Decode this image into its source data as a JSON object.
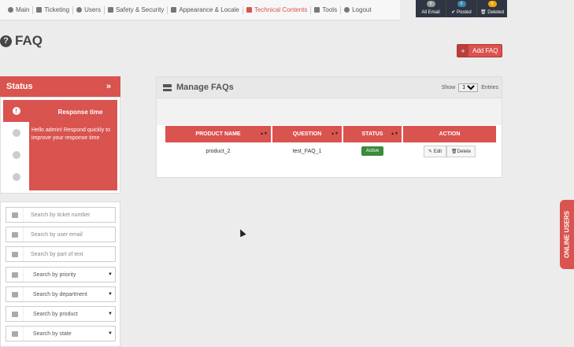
{
  "nav": {
    "items": [
      {
        "label": "Main",
        "icon": "target-icon"
      },
      {
        "label": "Ticketing",
        "icon": "tag-icon"
      },
      {
        "label": "Users",
        "icon": "users-icon"
      },
      {
        "label": "Safety & Security",
        "icon": "lock-icon"
      },
      {
        "label": "Appearance & Locale",
        "icon": "brush-icon"
      },
      {
        "label": "Technical Contents",
        "icon": "graduation-cap-icon"
      },
      {
        "label": "Tools",
        "icon": "wrench-icon"
      },
      {
        "label": "Logout",
        "icon": "logout-icon"
      }
    ],
    "active": "Technical Contents",
    "accent": "#d9534f"
  },
  "stats": [
    {
      "label": "All Email",
      "count": "0",
      "color": "#999999"
    },
    {
      "label": "Posted",
      "count": "0",
      "color": "#3a87ad"
    },
    {
      "label": "Deleted",
      "count": "0",
      "color": "#f0a30a"
    }
  ],
  "page": {
    "title": "FAQ",
    "add_button": "Add FAQ"
  },
  "status": {
    "header": "Status",
    "toggle": "»",
    "active_title": "Response time",
    "active_text": "Hello admin! Respond quickly to improve your response time"
  },
  "search": {
    "ticket_number": "Search by ticket number",
    "user_email": "Search by user email",
    "part_of_text": "Search by part of text",
    "priority": "Search by priority",
    "department": "Search by department",
    "product": "Search by product",
    "state": "Search by state"
  },
  "manage": {
    "title": "Manage FAQs",
    "show_label": "Show",
    "show_value": "10",
    "entries_label": "Entries",
    "columns": [
      "PRODUCT NAME",
      "QUESTION",
      "STATUS",
      "ACTION"
    ],
    "rows": [
      {
        "product": "product_2",
        "question": "test_FAQ_1",
        "status": "Active",
        "edit": "Edit",
        "delete": "Delete"
      }
    ]
  },
  "online_users": "ONLINE USERS"
}
